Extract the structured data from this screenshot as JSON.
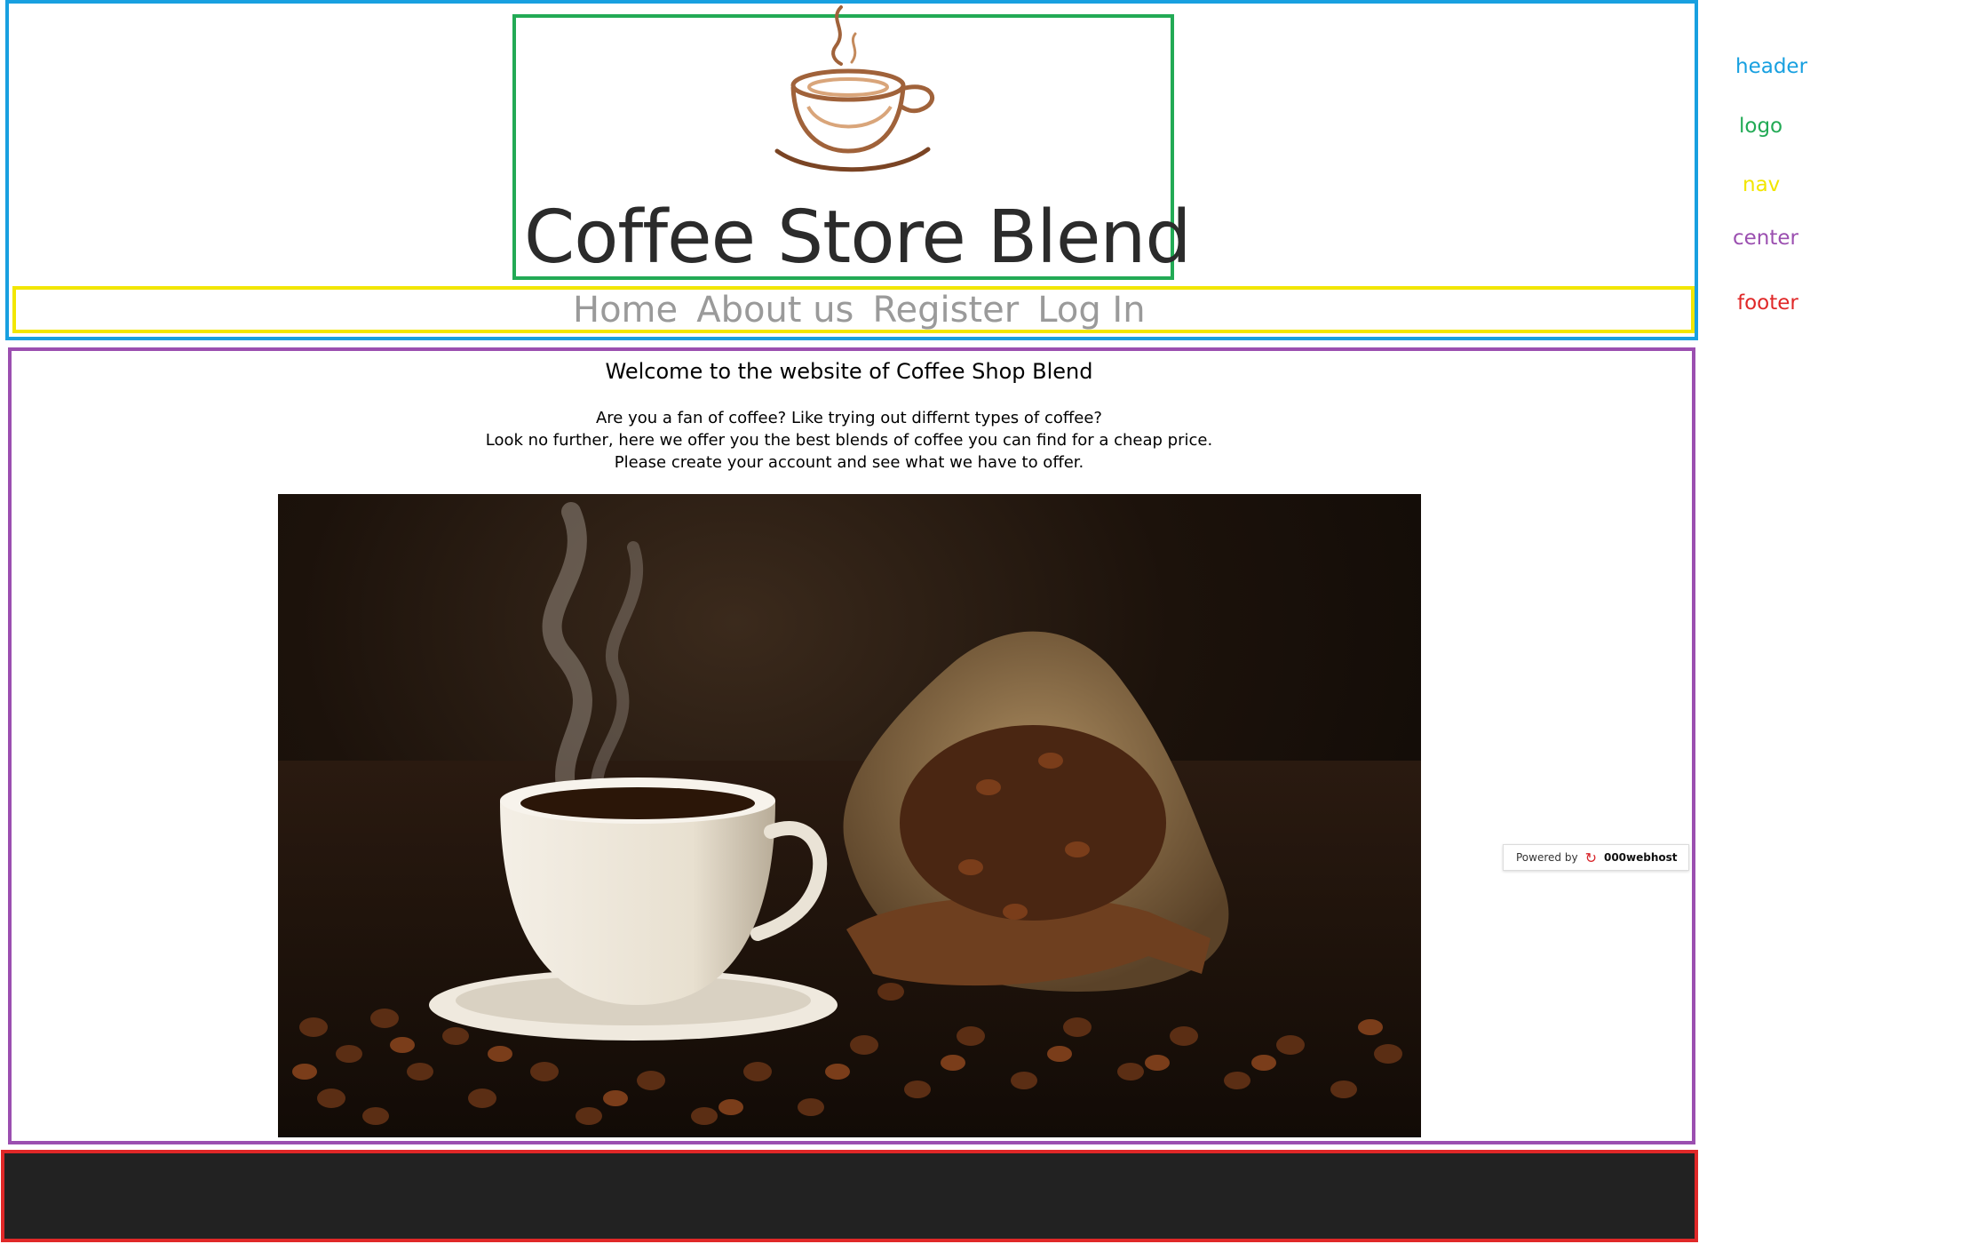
{
  "legend": {
    "header": "header",
    "logo": "logo",
    "nav": "nav",
    "center": "center",
    "footer": "footer"
  },
  "colors": {
    "header": "#18a0e0",
    "logo": "#22aa55",
    "nav": "#f2e600",
    "center": "#9b4fb0",
    "footer": "#e02828",
    "footer_bg": "#222222",
    "nav_text": "#9a9a9a",
    "cup_brown": "#a0623a"
  },
  "site": {
    "title": "Coffee Store Blend",
    "logo_icon": "coffee-cup-icon"
  },
  "nav": {
    "items": [
      {
        "label": "Home"
      },
      {
        "label": "About us"
      },
      {
        "label": "Register"
      },
      {
        "label": "Log In"
      }
    ]
  },
  "main": {
    "heading": "Welcome to the website of Coffee Shop Blend",
    "intro_lines": [
      "Are you a fan of coffee? Like trying out differnt types of coffee?",
      "Look no further, here we offer you the best blends of coffee you can find for a cheap price.",
      "Please create your account and see what we have to offer."
    ],
    "hero_image": "coffee-cup-and-beans-photo"
  },
  "badge": {
    "powered_by": "Powered by",
    "brand": "000webhost",
    "icon": "000webhost-logo-icon"
  }
}
